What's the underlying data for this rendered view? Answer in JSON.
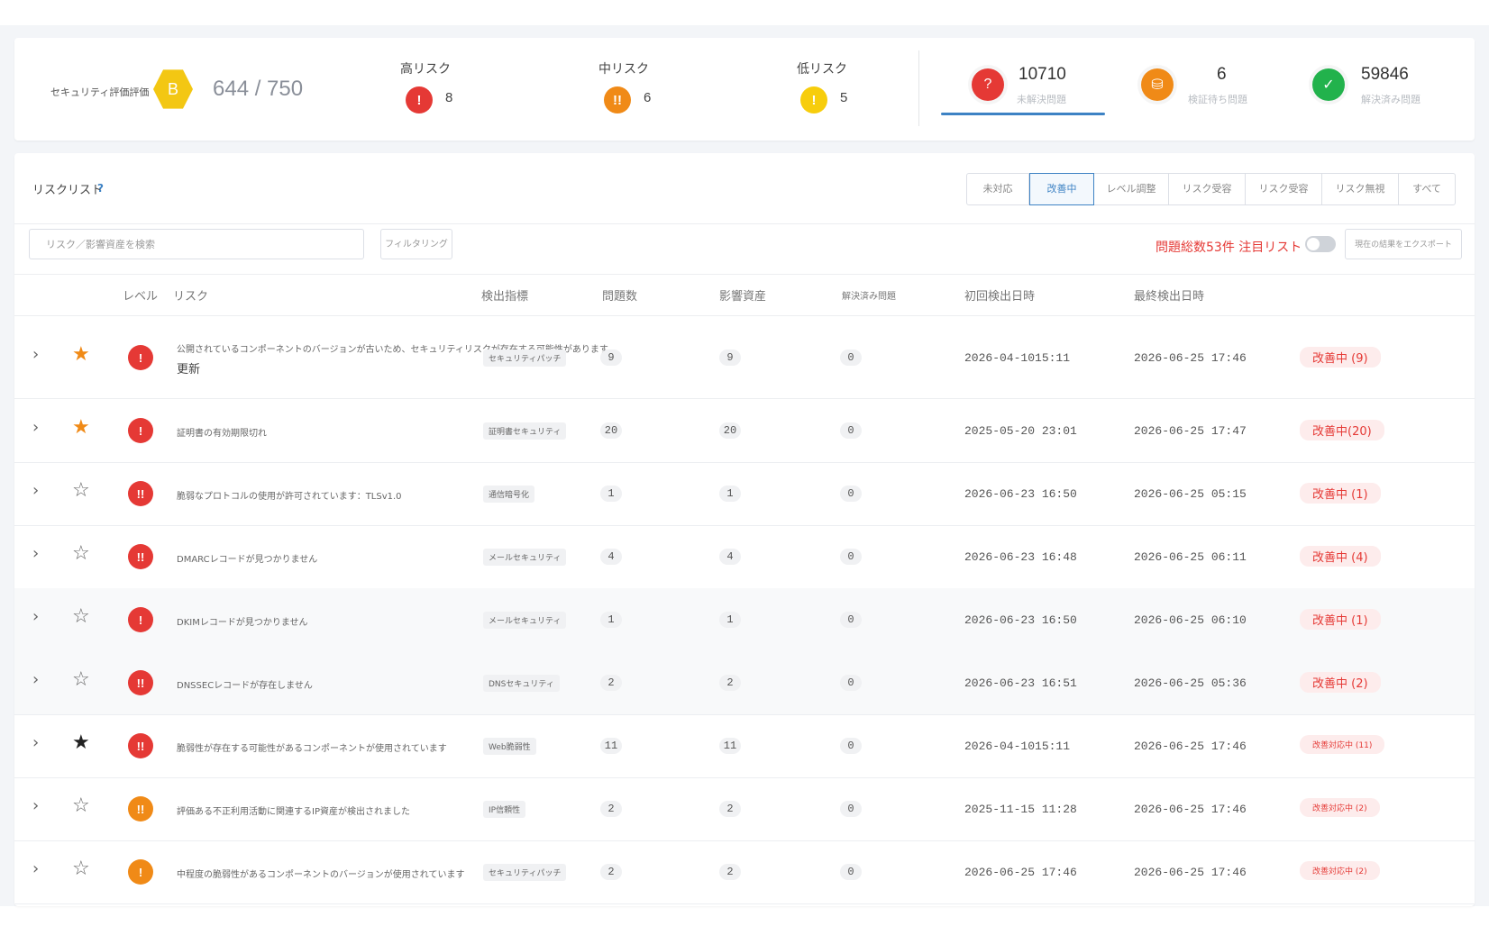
{
  "summary": {
    "score_label": "セキュリティ評価評価",
    "grade": "B",
    "score": "644 / 750",
    "risk_counts": [
      {
        "label": "高リスク",
        "icon": "!",
        "count": "8",
        "color": "#e53935"
      },
      {
        "label": "中リスク",
        "icon": "!!",
        "count": "6",
        "color": "#f08a17"
      },
      {
        "label": "低リスク",
        "icon": "!",
        "count": "5",
        "color": "#f7cd0c"
      }
    ],
    "stats": [
      {
        "number": "10710",
        "label": "未解決問題",
        "icon": "?",
        "icon_name": "question-icon"
      },
      {
        "number": "6",
        "label": "検証待ち問題",
        "icon": "⛁",
        "icon_name": "stack-icon"
      },
      {
        "number": "59846",
        "label": "解決済み問題",
        "icon": "✓",
        "icon_name": "check-icon"
      }
    ]
  },
  "list": {
    "title": "リスクリスト",
    "help": "?",
    "tabs": [
      "未対応",
      "改善中",
      "レベル調整",
      "リスク受容",
      "リスク受容",
      "リスク無視",
      "すべて"
    ],
    "active_tab_index": 1,
    "search_placeholder": "リスク／影響資産を検索",
    "filter_label": "フィルタリング",
    "issue_total": "問題総数53件",
    "watch_list_label": "注目リスト",
    "export_label": "現在の結果をエクスポート",
    "columns": {
      "level": "レベル",
      "risk": "リスク",
      "detection": "検出指標",
      "issues": "問題数",
      "affected": "影響資産",
      "resolved": "解決済み問題",
      "first": "初回検出日時",
      "last": "最終検出日時"
    },
    "rows": [
      {
        "starred": true,
        "star": "★",
        "level": "!",
        "level_color": "#e53935",
        "risk": "公開されているコンポーネントのバージョンが古いため、セキュリティリスクが存在する可能性があります",
        "risk_extra": "更新",
        "tag": "セキュリティパッチ",
        "issues": "9",
        "affected": "9",
        "resolved": "0",
        "first": "2026-04-1015:11",
        "last": "2026-06-25 17:46",
        "status": "改善中 (9)"
      },
      {
        "starred": true,
        "star": "★",
        "level": "!",
        "level_color": "#e53935",
        "risk": "証明書の有効期限切れ",
        "risk_extra": "",
        "tag": "証明書セキュリティ",
        "issues": "20",
        "affected": "20",
        "resolved": "0",
        "first": "2025-05-20 23:01",
        "last": "2026-06-25 17:47",
        "status": "改善中(20)"
      },
      {
        "starred": false,
        "star": "☆",
        "level": "!!",
        "level_color": "#e53935",
        "risk": "脆弱なプロトコルの使用が許可されています：TLSv1.0",
        "risk_extra": "",
        "tag": "通信暗号化",
        "issues": "1",
        "affected": "1",
        "resolved": "0",
        "first": "2026-06-23 16:50",
        "last": "2026-06-25 05:15",
        "status": "改善中 (1)"
      },
      {
        "starred": false,
        "star": "☆",
        "level": "!!",
        "level_color": "#e53935",
        "risk": "DMARCレコードが見つかりません",
        "risk_extra": "",
        "tag": "メールセキュリティ",
        "issues": "4",
        "affected": "4",
        "resolved": "0",
        "first": "2026-06-23 16:48",
        "last": "2026-06-25 06:11",
        "status": "改善中 (4)"
      },
      {
        "starred": false,
        "star": "☆",
        "level": "!",
        "level_color": "#e53935",
        "risk": "DKIMレコードが見つかりません",
        "risk_extra": "",
        "tag": "メールセキュリティ",
        "issues": "1",
        "affected": "1",
        "resolved": "0",
        "first": "2026-06-23 16:50",
        "last": "2026-06-25 06:10",
        "status": "改善中 (1)"
      },
      {
        "starred": false,
        "star": "☆",
        "level": "!!",
        "level_color": "#e53935",
        "risk": "DNSSECレコードが存在しません",
        "risk_extra": "",
        "tag": "DNSセキュリティ",
        "issues": "2",
        "affected": "2",
        "resolved": "0",
        "first": "2026-06-23 16:51",
        "last": "2026-06-25 05:36",
        "status": "改善中 (2)"
      },
      {
        "starred": true,
        "star": "★",
        "level": "!!",
        "level_color": "#e53935",
        "risk": "脆弱性が存在する可能性があるコンポーネントが使用されています",
        "risk_extra": "",
        "tag": "Web脆弱性",
        "issues": "11",
        "affected": "11",
        "resolved": "0",
        "first": "2026-04-1015:11",
        "last": "2026-06-25 17:46",
        "status": "改善対応中 (11)"
      },
      {
        "starred": false,
        "star": "☆",
        "level": "!!",
        "level_color": "#f08a17",
        "risk": "評価ある不正利用活動に関連するIP資産が検出されました",
        "risk_extra": "",
        "tag": "IP信頼性",
        "issues": "2",
        "affected": "2",
        "resolved": "0",
        "first": "2025-11-15 11:28",
        "last": "2026-06-25 17:46",
        "status": "改善対応中 (2)"
      },
      {
        "starred": false,
        "star": "☆",
        "level": "!",
        "level_color": "#f08a17",
        "risk": "中程度の脆弱性があるコンポーネントのバージョンが使用されています",
        "risk_extra": "",
        "tag": "セキュリティパッチ",
        "issues": "2",
        "affected": "2",
        "resolved": "0",
        "first": "2026-06-25 17:46",
        "last": "2026-06-25 17:46",
        "status": "改善対応中 (2)"
      }
    ]
  }
}
